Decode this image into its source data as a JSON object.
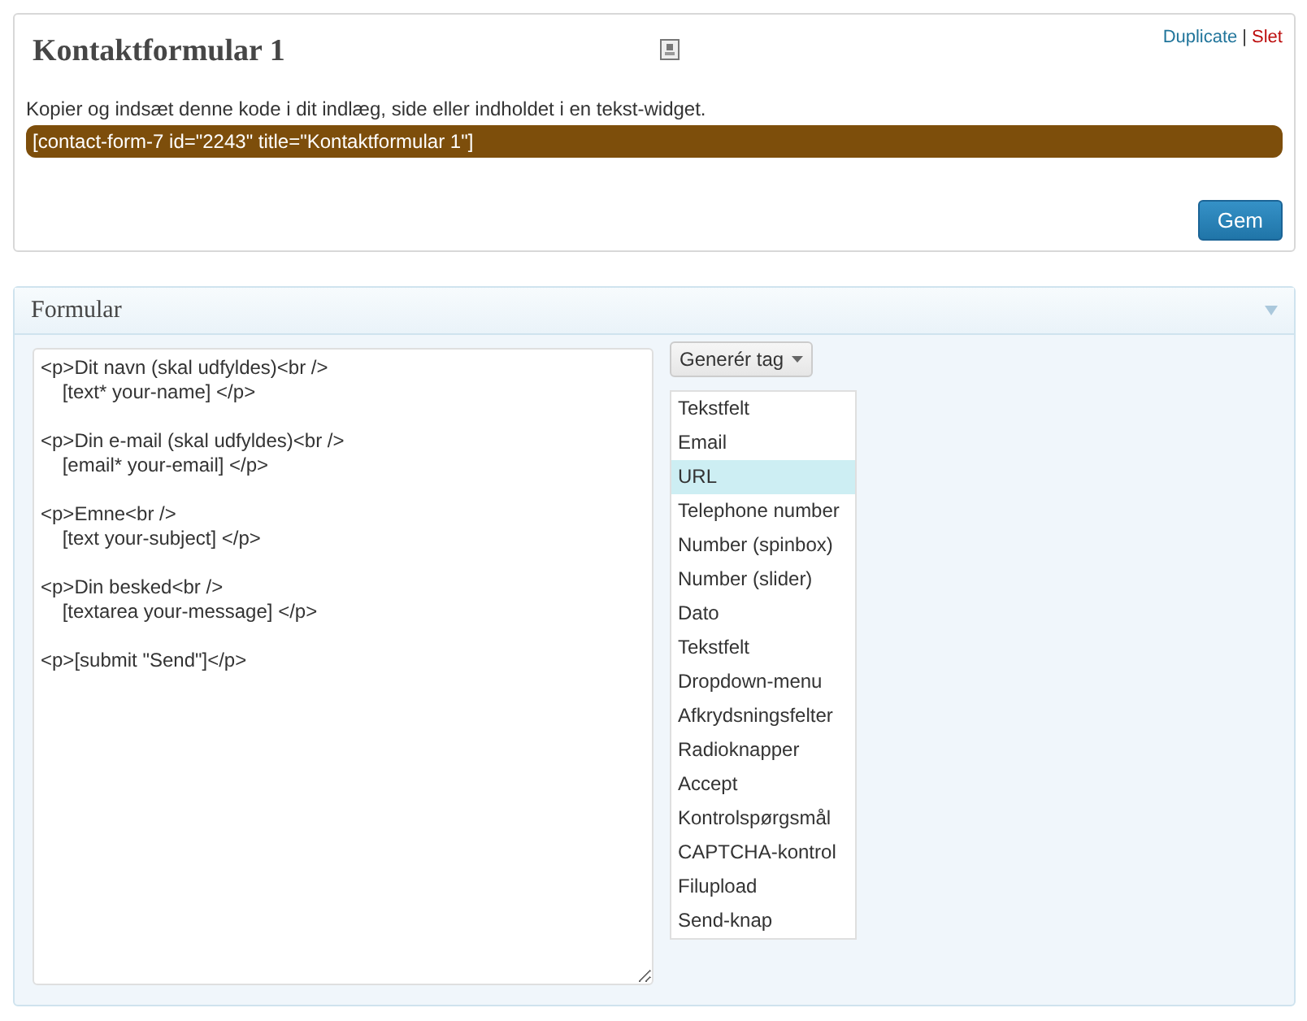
{
  "form_card": {
    "title": "Kontaktformular 1",
    "actions": [
      {
        "label": "Duplicate",
        "kind": "link"
      },
      {
        "label": "|",
        "kind": "separator"
      },
      {
        "label": "Slet",
        "kind": "delete"
      }
    ],
    "instructions": "Kopier og indsæt denne kode i dit indlæg, side eller indholdet i en tekst-widget.",
    "shortcode": "[contact-form-7 id=\"2243\" title=\"Kontaktformular 1\"]",
    "save_button": "Gem"
  },
  "form_panel": {
    "title": "Formular",
    "expanded": true,
    "code": "<p>Dit navn (skal udfyldes)<br />\n    [text* your-name] </p>\n\n<p>Din e-mail (skal udfyldes)<br />\n    [email* your-email] </p>\n\n<p>Emne<br />\n    [text your-subject] </p>\n\n<p>Din besked<br />\n    [textarea your-message] </p>\n\n<p>[submit \"Send\"]</p>",
    "tag_button": "Generér tag",
    "tag_menu": [
      {
        "label": "Tekstfelt",
        "selected": false
      },
      {
        "label": "Email",
        "selected": false
      },
      {
        "label": "URL",
        "selected": true
      },
      {
        "label": "Telephone number",
        "selected": false
      },
      {
        "label": "Number (spinbox)",
        "selected": false
      },
      {
        "label": "Number (slider)",
        "selected": false
      },
      {
        "label": "Dato",
        "selected": false
      },
      {
        "label": "Tekstfelt",
        "selected": false
      },
      {
        "label": "Dropdown-menu",
        "selected": false
      },
      {
        "label": "Afkrydsningsfelter",
        "selected": false
      },
      {
        "label": "Radioknapper",
        "selected": false
      },
      {
        "label": "Accept",
        "selected": false
      },
      {
        "label": "Kontrolspørgsmål",
        "selected": false
      },
      {
        "label": "CAPTCHA-kontrol",
        "selected": false
      },
      {
        "label": "Filupload",
        "selected": false
      },
      {
        "label": "Send-knap",
        "selected": false
      }
    ]
  }
}
